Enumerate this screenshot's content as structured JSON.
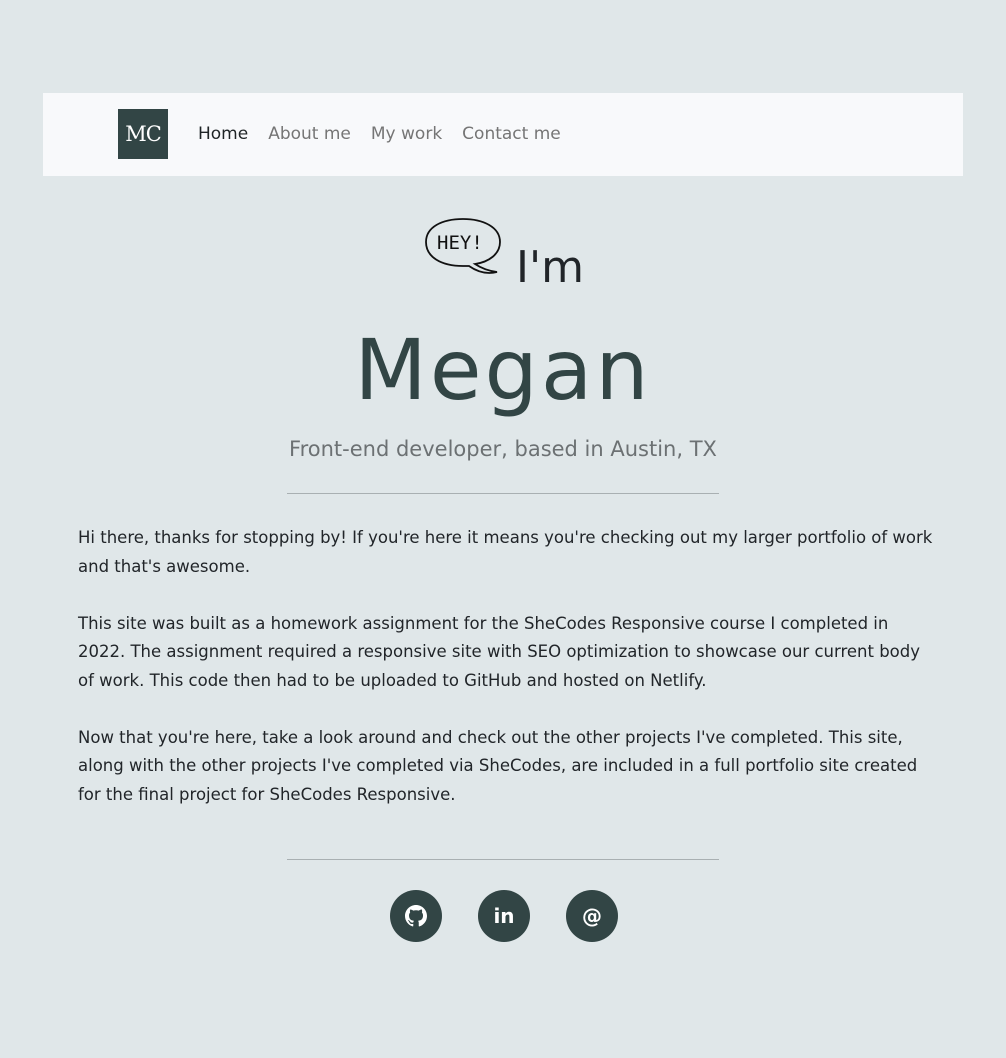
{
  "nav": {
    "logo_text": "MC",
    "links": [
      "Home",
      "About me",
      "My work",
      "Contact me"
    ],
    "active": "Home"
  },
  "hero": {
    "bubble_text": "HEY!",
    "im_text": "I'm",
    "name": "Megan",
    "subtitle": "Front-end developer, based in Austin, TX"
  },
  "bio": {
    "paragraphs": [
      "Hi there, thanks for stopping by! If you're here it means you're checking out my larger portfolio of work and that's awesome.",
      "This site was built as a homework assignment for the SheCodes Responsive course I completed in 2022. The assignment required a responsive site with SEO optimization to showcase our current body of work. This code then had to be uploaded to GitHub and hosted on Netlify.",
      "Now that you're here, take a look around and check out the other projects I've completed. This site, along with the other projects I've completed via SheCodes, are included in a full portfolio site created for the final project for SheCodes Responsive."
    ]
  },
  "socials": {
    "items": [
      {
        "icon": "github-icon"
      },
      {
        "icon": "linkedin-icon",
        "text": "in"
      },
      {
        "icon": "email-at-icon",
        "text": "@"
      }
    ]
  },
  "colors": {
    "background": "#e0e7e9",
    "navbar": "#f8f9fb",
    "accent": "#324545"
  }
}
